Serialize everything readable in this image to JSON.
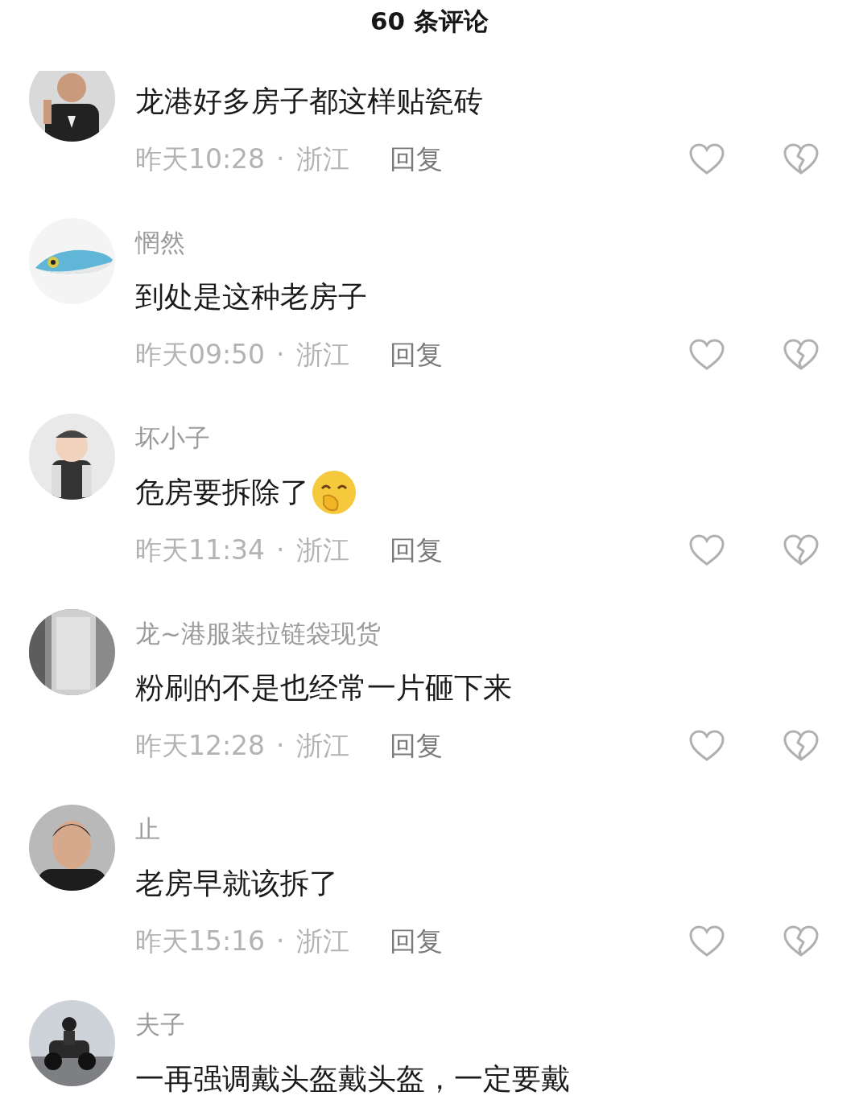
{
  "header": {
    "title": "60 条评论"
  },
  "comments": [
    {
      "text": "龙港好多房子都这样贴瓷砖",
      "time": "昨天10:28",
      "separator": "·",
      "location": "浙江",
      "reply": "回复",
      "liked": false,
      "disliked": false
    },
    {
      "name": "惘然",
      "text": "到处是这种老房子",
      "time": "昨天09:50",
      "separator": "·",
      "location": "浙江",
      "reply": "回复",
      "liked": false,
      "disliked": false
    },
    {
      "name": "坏小子",
      "text": "危房要拆除了",
      "emoji": true,
      "time": "昨天11:34",
      "separator": "·",
      "location": "浙江",
      "reply": "回复",
      "liked": false,
      "disliked": false
    },
    {
      "name": "龙~港服装拉链袋现货",
      "text": "粉刷的不是也经常一片砸下来",
      "time": "昨天12:28",
      "separator": "·",
      "location": "浙江",
      "reply": "回复",
      "liked": false,
      "disliked": false
    },
    {
      "name": "止",
      "text": "老房早就该拆了",
      "time": "昨天15:16",
      "separator": "·",
      "location": "浙江",
      "reply": "回复",
      "liked": false,
      "disliked": false
    },
    {
      "name": "夫子",
      "text": "一再强调戴头盔戴头盔，一定要戴"
    }
  ]
}
